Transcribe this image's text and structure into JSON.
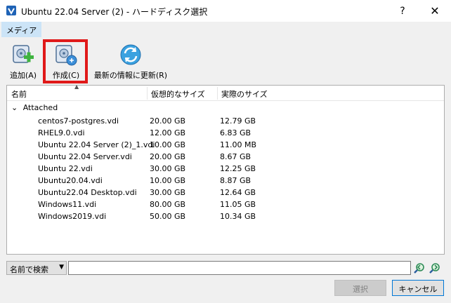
{
  "window": {
    "title": "Ubuntu 22.04 Server (2) - ハードディスク選択",
    "help": "?",
    "close": "✕"
  },
  "menu": {
    "media": "メディア"
  },
  "toolbar": {
    "add": "追加(A)",
    "create": "作成(C)",
    "refresh": "最新の情報に更新(R)"
  },
  "columns": {
    "name": "名前",
    "virtual": "仮想的なサイズ",
    "actual": "実際のサイズ"
  },
  "group": {
    "label": "Attached",
    "toggle": "⌄"
  },
  "rows": [
    {
      "name": "centos7-postgres.vdi",
      "virtual": "20.00 GB",
      "actual": "12.79 GB"
    },
    {
      "name": "RHEL9.0.vdi",
      "virtual": "12.00 GB",
      "actual": "6.83 GB"
    },
    {
      "name": "Ubuntu 22.04 Server (2)_1.vdi",
      "virtual": "10.00 GB",
      "actual": "11.00 MB"
    },
    {
      "name": "Ubuntu 22.04 Server.vdi",
      "virtual": "20.00 GB",
      "actual": "8.67 GB"
    },
    {
      "name": "Ubuntu 22.vdi",
      "virtual": "30.00 GB",
      "actual": "12.25 GB"
    },
    {
      "name": "Ubuntu20.04.vdi",
      "virtual": "10.00 GB",
      "actual": "8.87 GB"
    },
    {
      "name": "Ubuntu22.04 Desktop.vdi",
      "virtual": "30.00 GB",
      "actual": "12.64 GB"
    },
    {
      "name": "Windows11.vdi",
      "virtual": "80.00 GB",
      "actual": "11.05 GB"
    },
    {
      "name": "Windows2019.vdi",
      "virtual": "50.00 GB",
      "actual": "10.34 GB"
    }
  ],
  "search": {
    "mode": "名前で検索",
    "value": ""
  },
  "buttons": {
    "select": "選択",
    "cancel": "キャンセル"
  },
  "colors": {
    "highlight": "#e01919",
    "accent": "#0078d7"
  }
}
